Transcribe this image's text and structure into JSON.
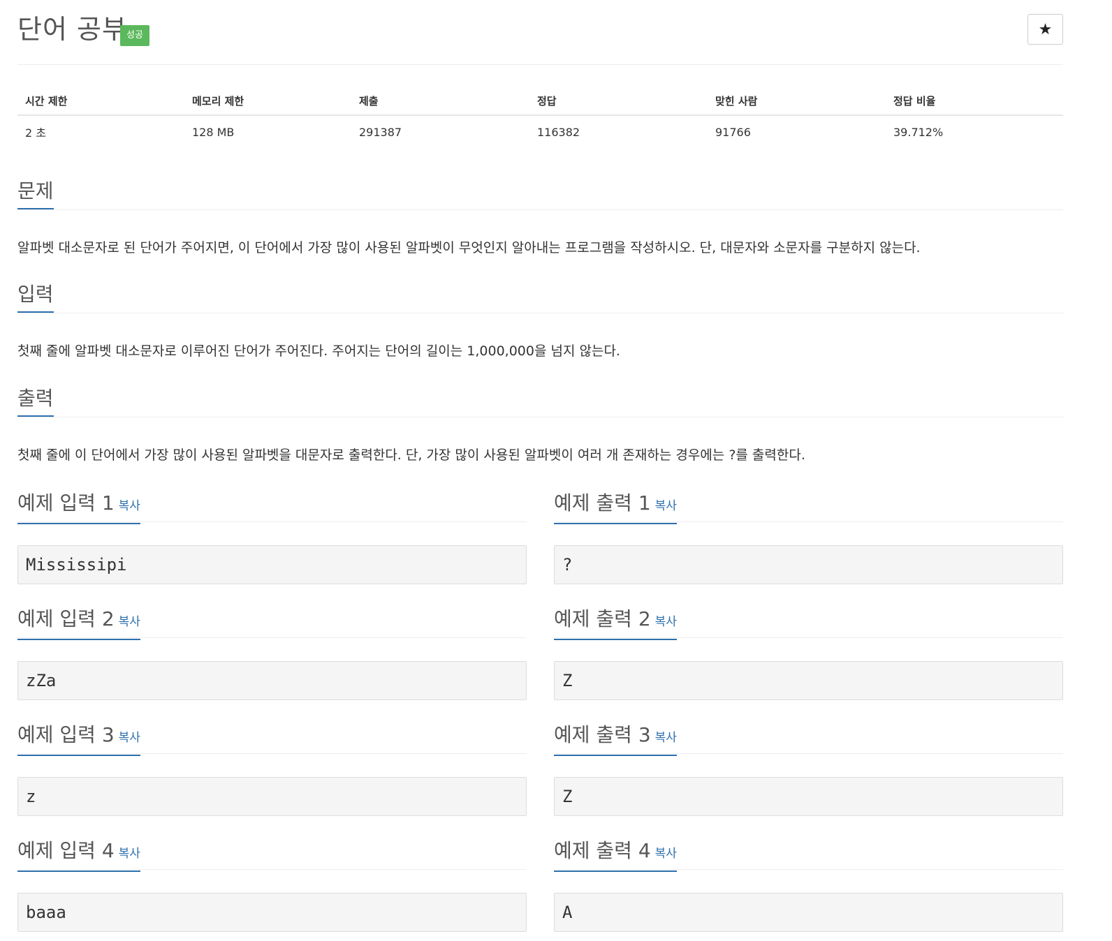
{
  "header": {
    "title": "단어 공부",
    "badge": "성공",
    "star": "★"
  },
  "stats": {
    "headers": [
      "시간 제한",
      "메모리 제한",
      "제출",
      "정답",
      "맞힌 사람",
      "정답 비율"
    ],
    "values": [
      "2 초",
      "128 MB",
      "291387",
      "116382",
      "91766",
      "39.712%"
    ]
  },
  "sections": [
    {
      "title": "문제",
      "text": "알파벳 대소문자로 된 단어가 주어지면, 이 단어에서 가장 많이 사용된 알파벳이 무엇인지 알아내는 프로그램을 작성하시오. 단, 대문자와 소문자를 구분하지 않는다."
    },
    {
      "title": "입력",
      "text": "첫째 줄에 알파벳 대소문자로 이루어진 단어가 주어진다. 주어지는 단어의 길이는 1,000,000을 넘지 않는다."
    },
    {
      "title": "출력",
      "text": "첫째 줄에 이 단어에서 가장 많이 사용된 알파벳을 대문자로 출력한다. 단, 가장 많이 사용된 알파벳이 여러 개 존재하는 경우에는 ?를 출력한다."
    }
  ],
  "examples": [
    {
      "in_title": "예제 입력 1",
      "out_title": "예제 출력 1",
      "copy": "복사",
      "input": "Mississipi",
      "output": "?"
    },
    {
      "in_title": "예제 입력 2",
      "out_title": "예제 출력 2",
      "copy": "복사",
      "input": "zZa",
      "output": "Z"
    },
    {
      "in_title": "예제 입력 3",
      "out_title": "예제 출력 3",
      "copy": "복사",
      "input": "z",
      "output": "Z"
    },
    {
      "in_title": "예제 입력 4",
      "out_title": "예제 출력 4",
      "copy": "복사",
      "input": "baaa",
      "output": "A"
    }
  ]
}
